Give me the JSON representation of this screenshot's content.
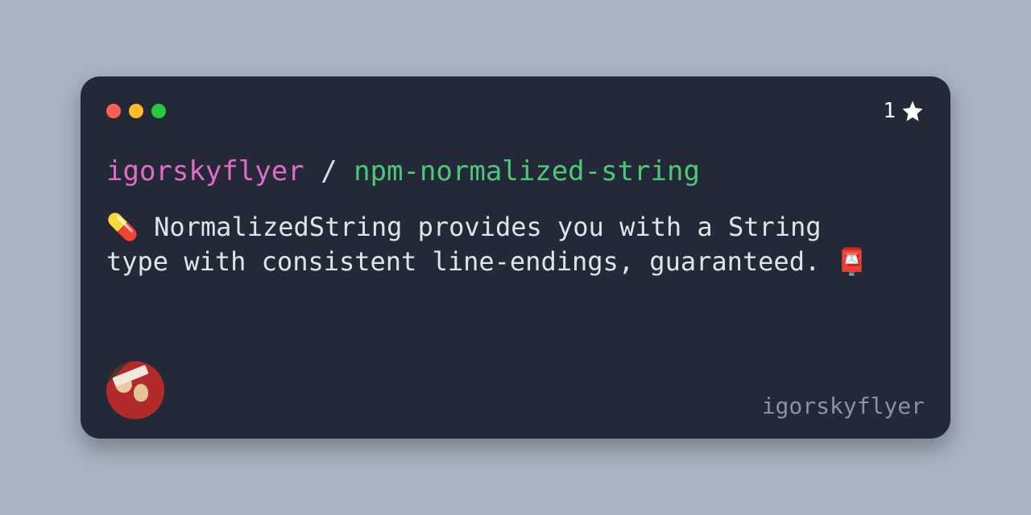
{
  "card": {
    "stars": "1",
    "owner": "igorskyflyer",
    "separator": " / ",
    "repo": "npm-normalized-string",
    "description": "💊 NormalizedString provides you with a String type with consistent line-endings, guaranteed. 📮",
    "username": "igorskyflyer"
  }
}
